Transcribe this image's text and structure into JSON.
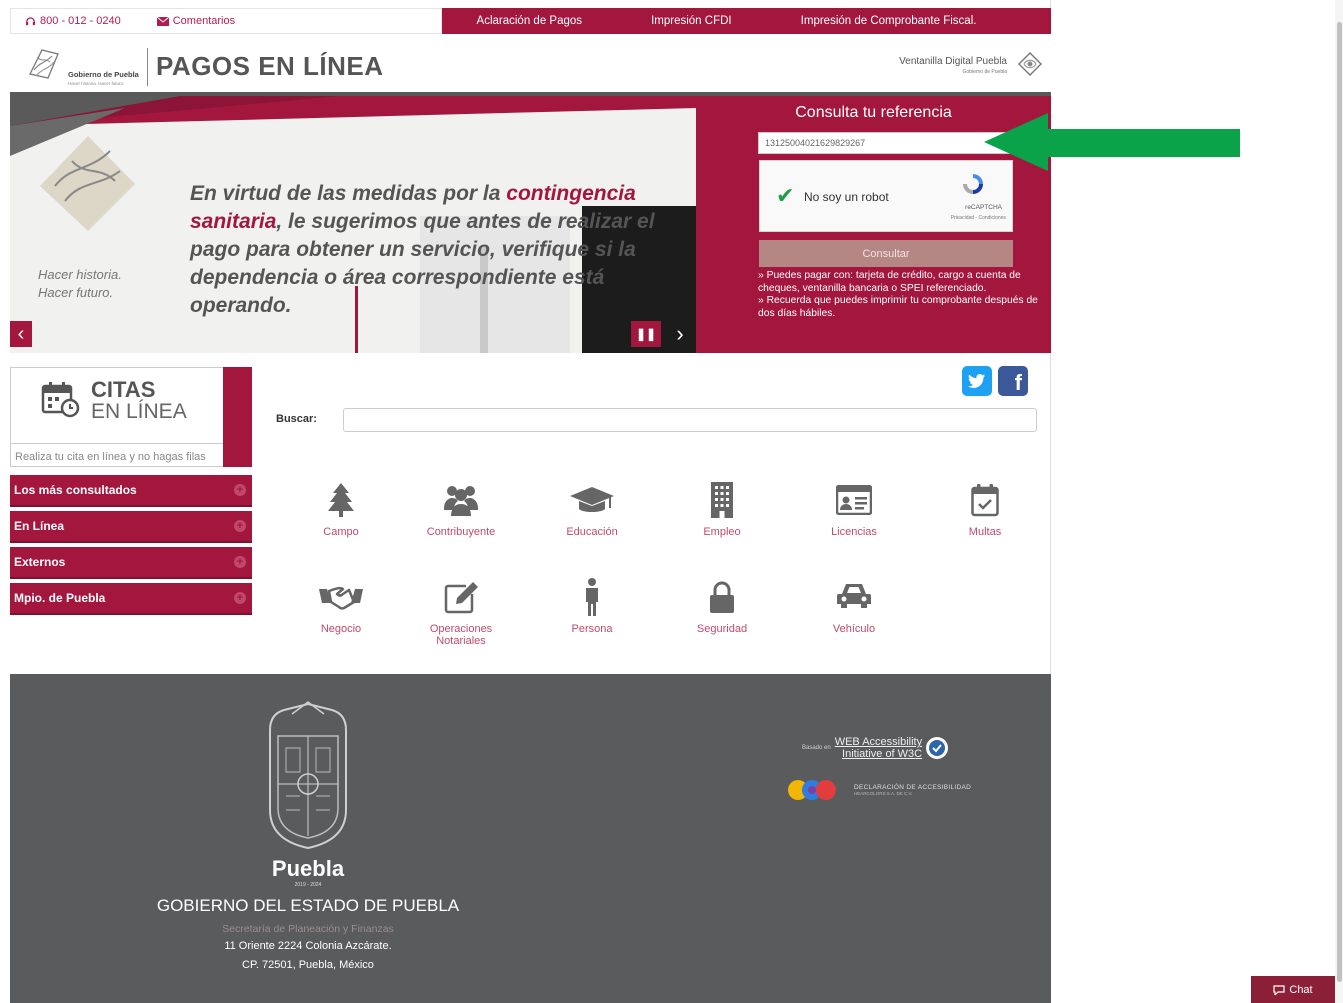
{
  "topbar": {
    "phone": "800 - 012 - 0240",
    "comments": "Comentarios",
    "links": [
      "Aclaración de Pagos",
      "Impresión CFDI",
      "Impresión de Comprobante Fiscal."
    ]
  },
  "header": {
    "logo_text": "Gobierno de Puebla",
    "logo_sub": "Hacer historia. Hacer futuro.",
    "title": "PAGOS EN LÍNEA",
    "right_title": "Ventanilla Digital Puebla",
    "right_sub": "Gobierno de Puebla"
  },
  "hero": {
    "slogan_1": "Hacer historia.",
    "slogan_2": "Hacer futuro.",
    "text_1": "En virtud de las medidas por la ",
    "text_hl1": "contingencia sanitaria",
    "text_2": ", le sugerimos que antes de realizar el pago para obtener un servicio, verifique si la dependencia o área correspondiente está operando.",
    "prev": "‹",
    "next": "›",
    "pause": "❚❚"
  },
  "consulta": {
    "title": "Consulta tu referencia",
    "reference_value": "1312500402162982926​7",
    "captcha_label": "No soy un robot",
    "captcha_brand": "reCAPTCHA",
    "captcha_terms": "Privacidad - Condiciones",
    "button": "Consultar",
    "info_1": "» Puedes pagar con: tarjeta de crédito, cargo a cuenta de cheques, ventanilla bancaria o SPEI referenciado.",
    "info_2": "» Recuerda que puedes imprimir tu comprobante después de dos días hábiles."
  },
  "citas": {
    "title_1": "CITAS",
    "title_2": "EN LÍNEA",
    "subtitle": "Realiza tu cita en línea y no hagas filas"
  },
  "menu": [
    "Los más consultados",
    "En Línea",
    "Externos",
    "Mpio. de Puebla"
  ],
  "search": {
    "label": "Buscar:",
    "value": ""
  },
  "categories": [
    {
      "label": "Campo",
      "icon": "tree-icon"
    },
    {
      "label": "Contribuyente",
      "icon": "users-icon"
    },
    {
      "label": "Educación",
      "icon": "graduation-cap-icon"
    },
    {
      "label": "Empleo",
      "icon": "building-icon"
    },
    {
      "label": "Licencias",
      "icon": "id-card-icon"
    },
    {
      "label": "Multas",
      "icon": "calendar-check-icon"
    },
    {
      "label": "Negocio",
      "icon": "handshake-icon"
    },
    {
      "label": "Operaciones Notariales",
      "icon": "edit-icon"
    },
    {
      "label": "Persona",
      "icon": "person-icon"
    },
    {
      "label": "Seguridad",
      "icon": "lock-icon"
    },
    {
      "label": "Vehículo",
      "icon": "car-icon"
    }
  ],
  "footer": {
    "puebla": "Puebla",
    "years": "2019 - 2024",
    "gob": "GOBIERNO DEL ESTADO DE PUEBLA",
    "secretaria": "Secretaría de Planeación y Finanzas",
    "address_1": "11 Oriente 2224 Colonia Azcárate.",
    "address_2": "CP. 72501, Puebla, México",
    "wai_prefix": "Basado en",
    "wai_1": "WEB Accessibility",
    "wai_2": "Initiative of W3C",
    "decl": "DECLARACIÓN DE ACCESIBILIDAD",
    "decl_sub": "HEARCOLORS S.A. DE C.V."
  },
  "chat": "Chat",
  "colors": {
    "brand": "#a3173f",
    "footer": "#595b5d",
    "arrow": "#0aa34a"
  }
}
